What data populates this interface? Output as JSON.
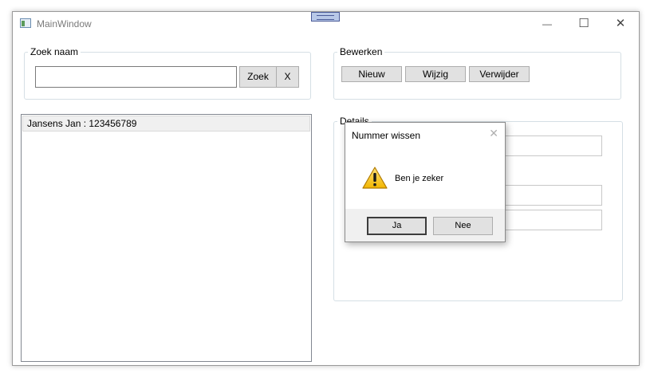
{
  "window": {
    "title": "MainWindow",
    "minimize": "—",
    "maximize": "☐",
    "close": "✕"
  },
  "search": {
    "group_label": "Zoek naam",
    "input_value": "",
    "search_button": "Zoek",
    "clear_button": "X"
  },
  "edit": {
    "group_label": "Bewerken",
    "new_button": "Nieuw",
    "change_button": "Wijzig",
    "delete_button": "Verwijder"
  },
  "list": {
    "items": [
      "Jansens Jan : 123456789"
    ]
  },
  "details": {
    "group_label": "Details",
    "field1": "",
    "field2": "",
    "field3": ""
  },
  "dialog": {
    "title": "Nummer wissen",
    "close": "✕",
    "icon": "warning-icon",
    "message": "Ben je zeker",
    "yes_button": "Ja",
    "no_button": "Nee"
  }
}
